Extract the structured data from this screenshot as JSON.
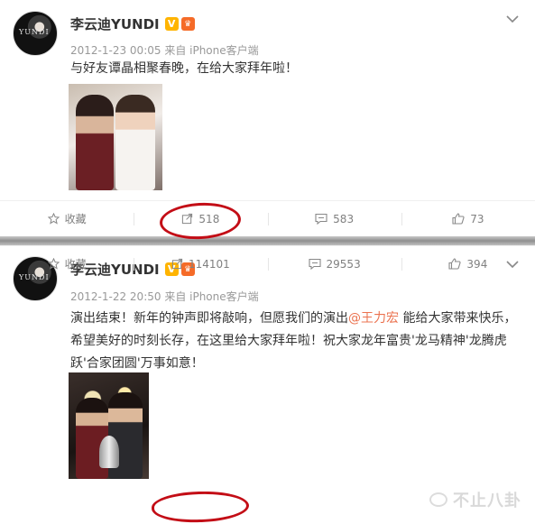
{
  "posts": [
    {
      "user_name": "李云迪YUNDI",
      "verified_badge": "V",
      "meta": "2012-1-23 00:05 来自 iPhone客户端",
      "text": "与好友谭晶相聚春晚，在给大家拜年啦！",
      "actions": {
        "favorite": "收藏",
        "repost": "518",
        "comment": "583",
        "like": "73"
      }
    },
    {
      "user_name": "李云迪YUNDI",
      "verified_badge": "V",
      "meta": "2012-1-22 20:50 来自 iPhone客户端",
      "text_before": "演出结束！新年的钟声即将敲响，但愿我们的演出",
      "mention": "@王力宏",
      "text_after": " 能给大家带来快乐，希望美好的时刻长存，在这里给大家拜年啦！祝大家龙年富贵'龙马精神'龙腾虎跃'合家团圆'万事如意！",
      "actions": {
        "favorite": "收藏",
        "repost": "114101",
        "comment": "29553",
        "like": "394"
      }
    }
  ],
  "avatar_text": "YUNDI",
  "watermark": "不止八卦",
  "colors": {
    "accent": "#eb7350",
    "verified": "#ffb400",
    "annotation": "#c30d16"
  }
}
